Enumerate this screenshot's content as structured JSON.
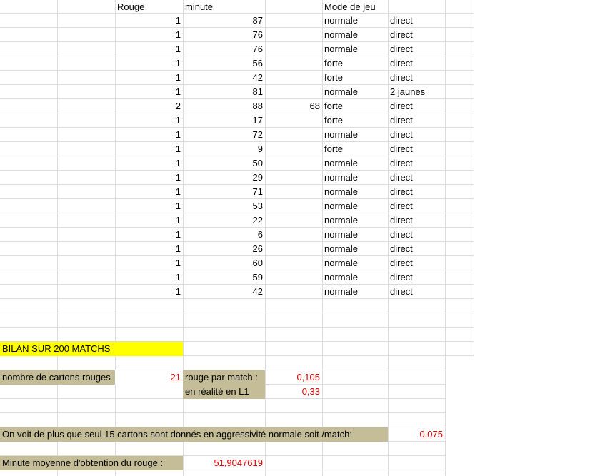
{
  "sheet": {
    "headers": {
      "rouge": "Rouge",
      "minute": "minute",
      "mode": "Mode de jeu"
    },
    "rows": [
      {
        "rouge": "1",
        "minute": "87",
        "extra": "",
        "mode": "normale",
        "type": "direct"
      },
      {
        "rouge": "1",
        "minute": "76",
        "extra": "",
        "mode": "normale",
        "type": "direct"
      },
      {
        "rouge": "1",
        "minute": "76",
        "extra": "",
        "mode": "normale",
        "type": "direct"
      },
      {
        "rouge": "1",
        "minute": "56",
        "extra": "",
        "mode": "forte",
        "type": "direct"
      },
      {
        "rouge": "1",
        "minute": "42",
        "extra": "",
        "mode": "forte",
        "type": "direct"
      },
      {
        "rouge": "1",
        "minute": "81",
        "extra": "",
        "mode": "normale",
        "type": "2 jaunes"
      },
      {
        "rouge": "2",
        "minute": "88",
        "extra": "68",
        "mode": "forte",
        "type": "direct"
      },
      {
        "rouge": "1",
        "minute": "17",
        "extra": "",
        "mode": "forte",
        "type": "direct"
      },
      {
        "rouge": "1",
        "minute": "72",
        "extra": "",
        "mode": "normale",
        "type": "direct"
      },
      {
        "rouge": "1",
        "minute": "9",
        "extra": "",
        "mode": "forte",
        "type": "direct"
      },
      {
        "rouge": "1",
        "minute": "50",
        "extra": "",
        "mode": "normale",
        "type": "direct"
      },
      {
        "rouge": "1",
        "minute": "29",
        "extra": "",
        "mode": "normale",
        "type": "direct"
      },
      {
        "rouge": "1",
        "minute": "71",
        "extra": "",
        "mode": "normale",
        "type": "direct"
      },
      {
        "rouge": "1",
        "minute": "53",
        "extra": "",
        "mode": "normale",
        "type": "direct"
      },
      {
        "rouge": "1",
        "minute": "22",
        "extra": "",
        "mode": "normale",
        "type": "direct"
      },
      {
        "rouge": "1",
        "minute": "6",
        "extra": "",
        "mode": "normale",
        "type": "direct"
      },
      {
        "rouge": "1",
        "minute": "26",
        "extra": "",
        "mode": "normale",
        "type": "direct"
      },
      {
        "rouge": "1",
        "minute": "60",
        "extra": "",
        "mode": "normale",
        "type": "direct"
      },
      {
        "rouge": "1",
        "minute": "59",
        "extra": "",
        "mode": "normale",
        "type": "direct"
      },
      {
        "rouge": "1",
        "minute": "42",
        "extra": "",
        "mode": "normale",
        "type": "direct"
      }
    ],
    "summary": {
      "title": "BILAN SUR 200 MATCHS",
      "nb_cartons_label": "nombre de cartons rouges",
      "nb_cartons_value": "21",
      "rouge_par_match_label": "rouge par match :",
      "rouge_par_match_value": "0,105",
      "realite_label": "en réalité en L1",
      "realite_value": "0,33",
      "aggressivite_label": "On voit de plus que seul 15 cartons sont donnés en aggressivité normale soit /match:",
      "aggressivite_value": "0,075",
      "minute_moyenne_label": "Minute moyenne d'obtention du rouge :",
      "minute_moyenne_value": "51,9047619"
    }
  },
  "colors": {
    "gridline": "#dadcdd",
    "highlight_yellow": "#ffff00",
    "label_tan": "#c4bd97",
    "value_red": "#e00000"
  }
}
